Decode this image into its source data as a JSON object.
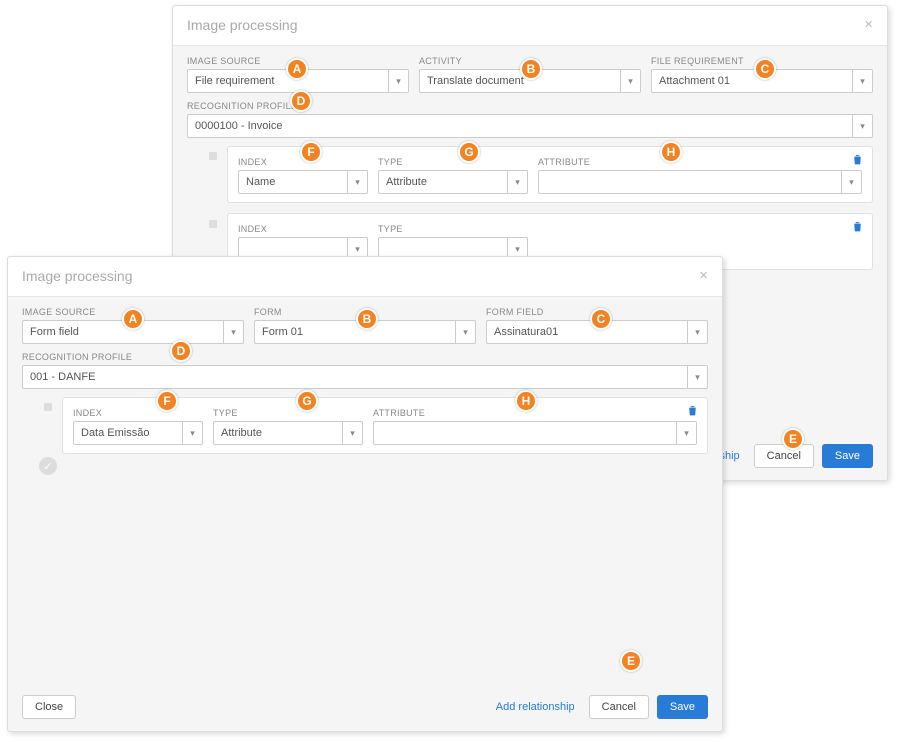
{
  "markers": {
    "A": "A",
    "B": "B",
    "C": "C",
    "D": "D",
    "E": "E",
    "F": "F",
    "G": "G",
    "H": "H"
  },
  "back": {
    "title": "Image processing",
    "labels": {
      "imgsrc": "IMAGE SOURCE",
      "activity": "ACTIVITY",
      "filereq": "FILE REQUIREMENT",
      "recprof": "RECOGNITION PROFILE",
      "index": "INDEX",
      "type": "TYPE",
      "attribute": "ATTRIBUTE"
    },
    "values": {
      "imgsrc": "File requirement",
      "activity": "Translate document",
      "filereq": "Attachment 01",
      "recprof": "0000100 - Invoice",
      "row1_index": "Name",
      "row1_type": "Attribute",
      "row1_attr": "",
      "row2_index": "",
      "row2_type": ""
    },
    "actions": {
      "add": "Add relationship",
      "cancel": "Cancel",
      "save": "Save"
    }
  },
  "front": {
    "title": "Image processing",
    "labels": {
      "imgsrc": "IMAGE SOURCE",
      "form": "FORM",
      "formfield": "FORM FIELD",
      "recprof": "RECOGNITION PROFILE",
      "index": "INDEX",
      "type": "TYPE",
      "attribute": "ATTRIBUTE"
    },
    "values": {
      "imgsrc": "Form field",
      "form": "Form 01",
      "formfield": "Assinatura01",
      "recprof": "001 - DANFE",
      "row1_index": "Data Emissão",
      "row1_type": "Attribute",
      "row1_attr": ""
    },
    "actions": {
      "add": "Add relationship",
      "close": "Close",
      "cancel": "Cancel",
      "save": "Save"
    }
  }
}
